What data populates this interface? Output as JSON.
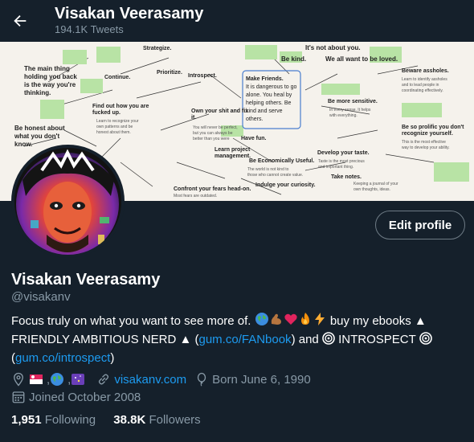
{
  "header": {
    "title": "Visakan Veerasamy",
    "tweet_count": "194.1K Tweets"
  },
  "banner": {
    "notes": {
      "n1": "The main thing holding you back is the way you're thinking.",
      "n2": "Be honest about what you don't know.",
      "n3": "Find out how you are fucked up.",
      "n4": "Own your shit and fix it.",
      "n5": "Learn project management.",
      "n6": "Make Friends.",
      "n7": "It's not about you.",
      "n8": "Be kind.",
      "n9": "We all want to be loved.",
      "n10": "Beware assholes.",
      "n11": "Be more sensitive.",
      "n12": "Have fun.",
      "n13": "Be Economically Useful.",
      "n14": "Develop your taste.",
      "n15": "Take notes.",
      "n16": "Confront your fears head-on.",
      "n17": "Indulge your curiosity.",
      "n18": "Be so prolific you don't recognize yourself.",
      "n19": "Strategize.",
      "n20": "Introspect.",
      "n21": "Continue.",
      "n22": "Prioritize."
    }
  },
  "profile": {
    "name": "Visakan Veerasamy",
    "handle": "@visakanv",
    "edit_label": "Edit profile",
    "bio_line1": "Focus truly on what you want to see more of.",
    "bio_line1_after": " buy my ebooks ▲",
    "bio_line2_pre": "FRIENDLY AMBITIOUS NERD ▲ (",
    "bio_link1": "gum.co/FANbook",
    "bio_line2_post": ") and ",
    "bio_line2_end": " INTROSPECT ",
    "bio_line3_pre": "(",
    "bio_link2": "gum.co/introspect",
    "bio_line3_post": ")",
    "location_sep": ", ",
    "website": "visakanv.com",
    "birthday": "Born June 6, 1990",
    "joined": "Joined October 2008",
    "following_count": "1,951",
    "following_label": "Following",
    "followers_count": "38.8K",
    "followers_label": "Followers"
  },
  "colors": {
    "background": "#15202b",
    "accent": "#1d9bf0",
    "secondary_text": "#8899a6"
  },
  "icons": {
    "back": "arrow-left-icon",
    "location": "location-pin-icon",
    "link": "link-icon",
    "birthday": "balloon-icon",
    "calendar": "calendar-icon"
  }
}
